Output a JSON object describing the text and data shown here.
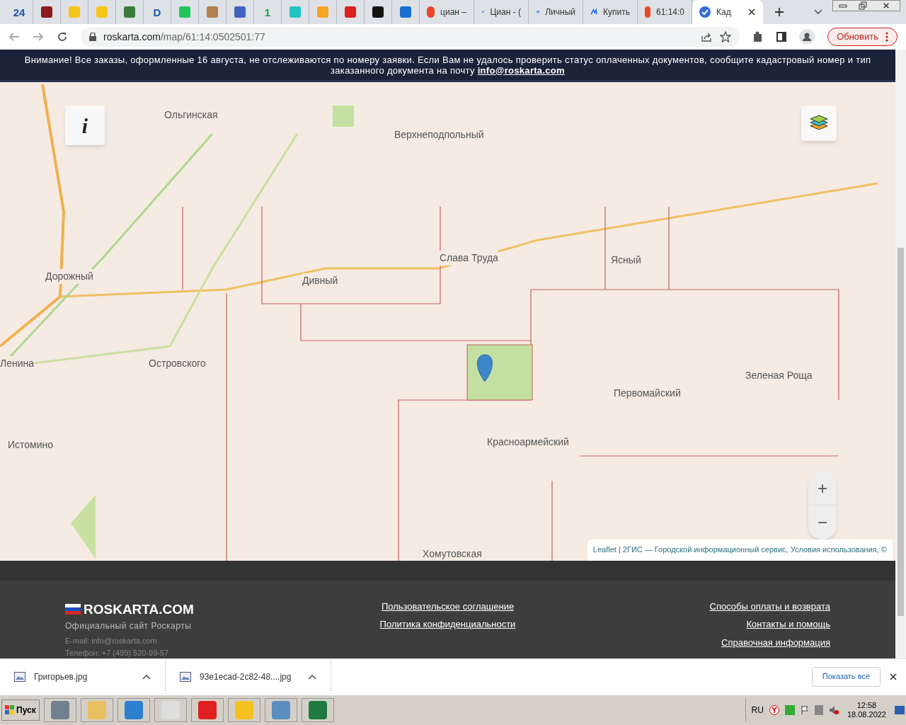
{
  "browser": {
    "tabs": [
      {
        "kind": "pinned",
        "glyph": "24",
        "selected": false
      },
      {
        "kind": "pinned",
        "selected": false
      },
      {
        "kind": "pinned",
        "selected": false
      },
      {
        "kind": "pinned",
        "selected": false
      },
      {
        "kind": "pinned",
        "selected": false
      },
      {
        "kind": "pinned",
        "glyph": "D",
        "selected": false
      },
      {
        "kind": "pinned",
        "selected": false
      },
      {
        "kind": "pinned",
        "selected": false
      },
      {
        "kind": "pinned",
        "selected": false
      },
      {
        "kind": "pinned",
        "glyph": "1",
        "selected": false
      },
      {
        "kind": "pinned",
        "selected": false
      },
      {
        "kind": "pinned",
        "selected": false
      },
      {
        "kind": "pinned",
        "selected": false
      },
      {
        "kind": "pinned",
        "selected": false
      },
      {
        "kind": "pinned",
        "selected": false
      },
      {
        "kind": "titled",
        "title": "циан –",
        "selected": false
      },
      {
        "kind": "titled",
        "title": "Циан - (",
        "selected": false
      },
      {
        "kind": "titled",
        "title": "Личный",
        "selected": false
      },
      {
        "kind": "titled",
        "title": "Купить",
        "selected": false
      },
      {
        "kind": "titled",
        "title": "61:14:0",
        "selected": false
      },
      {
        "kind": "titled",
        "title": "Кад",
        "selected": true
      }
    ],
    "url_host": "roskarta.com",
    "url_path": "/map/61:14:0502501:77",
    "update_button": "Обновить"
  },
  "banner": {
    "text": "Внимание! Все заказы, оформленные 16 августа, не отслеживаются по номеру заявки. Если Вам не удалось проверить статус оплаченных документов, сообщите кадастровый номер и тип заказанного документа на почту",
    "email": "info@roskarta.com"
  },
  "map": {
    "places": [
      "Ольгинская",
      "Верхнеподпольный",
      "Слава Труда",
      "Ясный",
      "Дорожный",
      "Дивный",
      "Ленина",
      "Островского",
      "Зеленая Роща",
      "Первомайский",
      "Истомино",
      "Красноармейский",
      "Хомутовская"
    ],
    "info_button": "i",
    "zoom_buttons": [
      "+",
      "−"
    ],
    "attribution": "Leaflet | 2ГИС — Городской информационный сервис, Условия использования, ©"
  },
  "footer": {
    "logo": "ROSKARTA.COM",
    "tagline": "Официальный сайт Роскарты",
    "email": "E-mail: info@roskarta.com",
    "phone": "Телефон: +7 (499) 520-99-57",
    "links_center": [
      "Пользовательское соглашение",
      "Политика конфиденциальности"
    ],
    "links_right": [
      "Способы оплаты и возврата",
      "Контакты и помощь",
      "Справочная информация"
    ]
  },
  "downloads": {
    "items": [
      "Григорьев.jpg",
      "93e1ecad-2c82-48....jpg"
    ],
    "show_all": "Показать все"
  },
  "taskbar": {
    "start": "Пуск",
    "language": "RU",
    "time": "12:58",
    "date": "18.08.2022"
  }
}
